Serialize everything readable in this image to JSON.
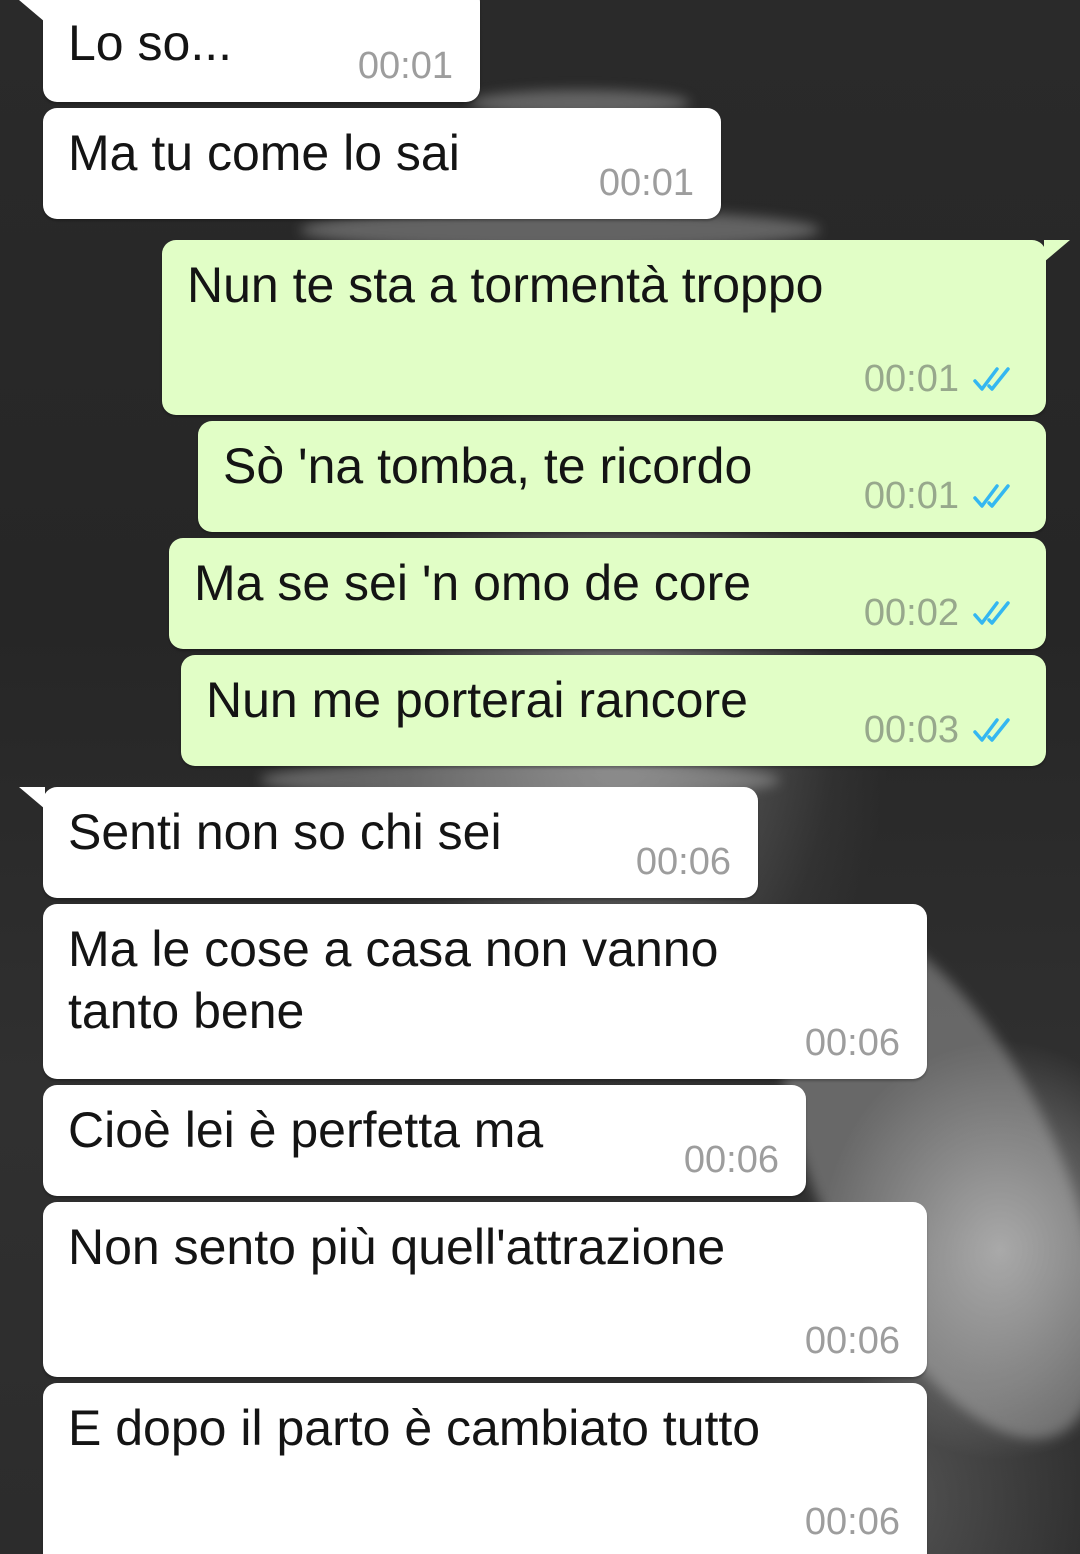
{
  "colors": {
    "incoming_bubble": "#ffffff",
    "outgoing_bubble": "#e1fec6",
    "read_ticks": "#34b7f1",
    "timestamp": "#9d9d9d"
  },
  "messages": [
    {
      "direction": "in",
      "text": "Lo so...",
      "time": "00:01"
    },
    {
      "direction": "in",
      "text": "Ma tu come lo sai",
      "time": "00:01"
    },
    {
      "direction": "out",
      "text": "Nun te sta a tormentà troppo",
      "time": "00:01",
      "status_icon": "double-check-icon"
    },
    {
      "direction": "out",
      "text": "Sò 'na tomba, te ricordo",
      "time": "00:01",
      "status_icon": "double-check-icon"
    },
    {
      "direction": "out",
      "text": "Ma se sei 'n omo de core",
      "time": "00:02",
      "status_icon": "double-check-icon"
    },
    {
      "direction": "out",
      "text": "Nun me porterai rancore",
      "time": "00:03",
      "status_icon": "double-check-icon"
    },
    {
      "direction": "in",
      "text": "Senti non so chi sei",
      "time": "00:06"
    },
    {
      "direction": "in",
      "text": "Ma le cose a casa non vanno\ntanto bene",
      "time": "00:06"
    },
    {
      "direction": "in",
      "text": "Cioè lei è perfetta ma",
      "time": "00:06"
    },
    {
      "direction": "in",
      "text": "Non sento più quell'attrazione",
      "time": "00:06"
    },
    {
      "direction": "in",
      "text": "E dopo il parto è cambiato tutto",
      "time": "00:06"
    }
  ]
}
